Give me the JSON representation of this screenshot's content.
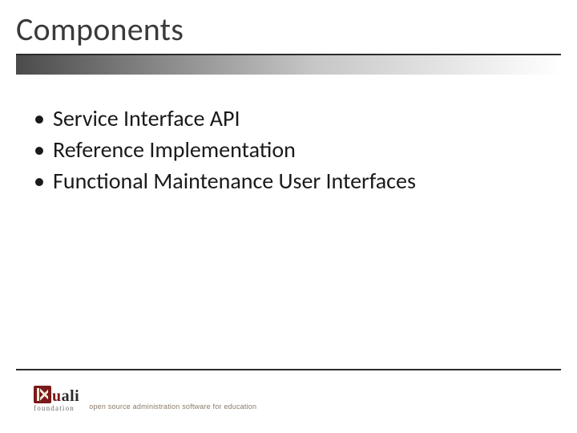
{
  "title": "Components",
  "bullets": [
    "Service Interface API",
    "Reference Implementation",
    "Functional Maintenance User Interfaces"
  ],
  "logo": {
    "word_prefix": "u",
    "word_suffix": "ali",
    "subtext": "foundation",
    "tagline": "open source administration software for education"
  }
}
